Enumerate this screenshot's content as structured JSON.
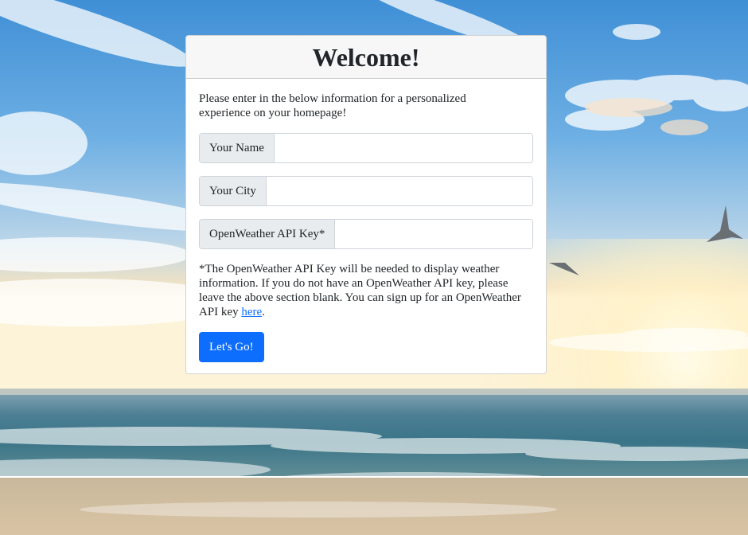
{
  "card": {
    "title": "Welcome!",
    "intro": "Please enter in the below information for a personalized experience on your homepage!"
  },
  "fields": {
    "name": {
      "label": "Your Name",
      "value": "",
      "placeholder": ""
    },
    "city": {
      "label": "Your City",
      "value": "",
      "placeholder": ""
    },
    "api_key": {
      "label": "OpenWeather API Key*",
      "value": "",
      "placeholder": ""
    }
  },
  "note": {
    "text": "*The OpenWeather API Key will be needed to display weather information. If you do not have an OpenWeather API key, please leave the above section blank. You can sign up for an OpenWeather API key ",
    "link_text": "here",
    "suffix": "."
  },
  "submit": {
    "label": "Let's Go!"
  },
  "colors": {
    "primary": "#0d6efd",
    "text": "#212529",
    "addon_bg": "#e9ecef",
    "header_bg": "#f7f7f7"
  },
  "background": {
    "icon": "beach-sky-seagulls"
  }
}
